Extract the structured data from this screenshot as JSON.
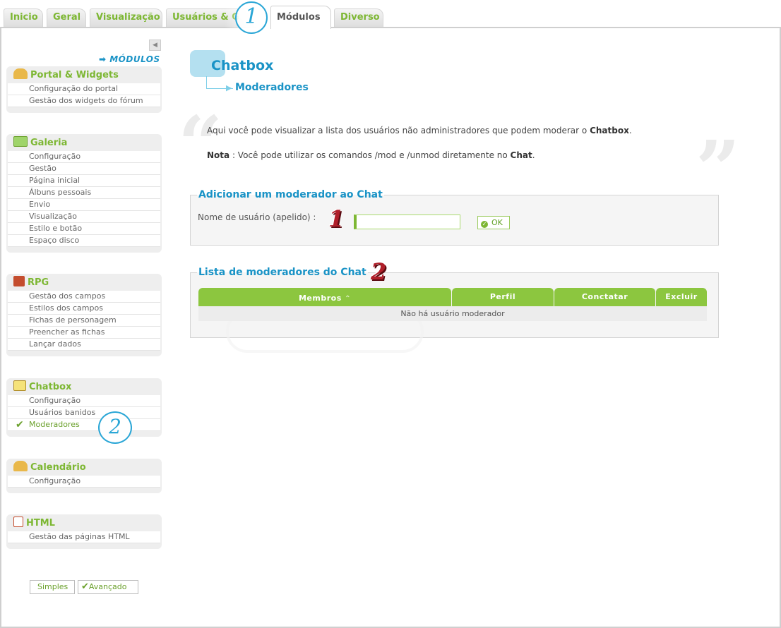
{
  "tabs": [
    "Inicio",
    "Geral",
    "Visualização",
    "Usuários & G",
    "Módulos",
    "Diverso"
  ],
  "active_tab": "Módulos",
  "callouts": {
    "tab": "1",
    "sidebar": "2",
    "input": "1",
    "list": "2"
  },
  "sidebar": {
    "collapse_icon": "arrow-left-icon",
    "modules_link": "➡ MÓDULOS",
    "menus": [
      {
        "title": "Portal & Widgets",
        "icon": "house-icon",
        "items": [
          "Configuração do portal",
          "Gestão dos widgets do fórum"
        ]
      },
      {
        "title": "Galeria",
        "icon": "photos-icon",
        "items": [
          "Configuração",
          "Gestão",
          "Página inicial",
          "Álbuns pessoais",
          "Envio",
          "Visualização",
          "Estilo e botão",
          "Espaço disco"
        ]
      },
      {
        "title": "RPG",
        "icon": "dice-icon",
        "items": [
          "Gestão dos campos",
          "Estilos dos campos",
          "Fichas de personagem",
          "Preencher as fichas",
          "Lançar dados"
        ]
      },
      {
        "title": "Chatbox",
        "icon": "chat-icon",
        "items": [
          "Configuração",
          "Usuários banidos",
          "Moderadores"
        ],
        "active_item": "Moderadores"
      },
      {
        "title": "Calendário",
        "icon": "house-icon",
        "items": [
          "Configuração"
        ]
      },
      {
        "title": "HTML",
        "icon": "html-page-icon",
        "items": [
          "Gestão das páginas HTML"
        ]
      }
    ],
    "mode_simple": "Simples",
    "mode_advanced": "Avançado"
  },
  "main": {
    "title": "Chatbox",
    "subtitle": "Moderadores",
    "intro_prefix": "Aqui você pode visualizar a lista dos usuários não administradores que podem moderar o ",
    "intro_bold": "Chatbox",
    "intro_suffix": ".",
    "note_label": "Nota",
    "note_prefix": " : Você pode utilizar os comandos /mod e /unmod diretamente no ",
    "note_bold": "Chat",
    "note_suffix": ".",
    "add_section": {
      "legend": "Adicionar um moderador ao Chat",
      "username_label": "Nome de usuário (apelido) :",
      "username_value": "",
      "ok_label": "OK"
    },
    "list_section": {
      "legend": "Lista de moderadores do Chat",
      "columns": [
        "Membros",
        "Perfil",
        "Conctatar",
        "Excluir"
      ],
      "sort_indicator": "⌃",
      "empty_message": "Não há usuário moderador"
    }
  }
}
